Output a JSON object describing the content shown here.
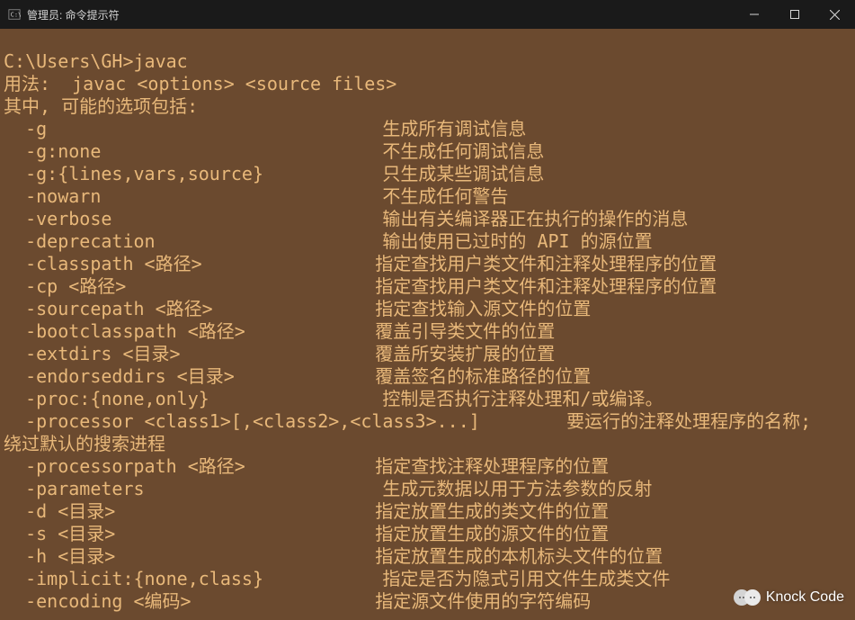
{
  "window": {
    "title": "管理员: 命令提示符"
  },
  "terminal": {
    "prompt_prefix": "C:\\Users\\GH>",
    "command": "javac",
    "usage_label": "用法:",
    "usage_cmd": "javac <options> <source files>",
    "options_intro": "其中, 可能的选项包括:",
    "options": [
      {
        "flag": "-g",
        "desc": "生成所有调试信息"
      },
      {
        "flag": "-g:none",
        "desc": "不生成任何调试信息"
      },
      {
        "flag": "-g:{lines,vars,source}",
        "desc": "只生成某些调试信息"
      },
      {
        "flag": "-nowarn",
        "desc": "不生成任何警告"
      },
      {
        "flag": "-verbose",
        "desc": "输出有关编译器正在执行的操作的消息"
      },
      {
        "flag": "-deprecation",
        "desc": "输出使用已过时的 API 的源位置"
      },
      {
        "flag": "-classpath <路径>",
        "desc": "指定查找用户类文件和注释处理程序的位置"
      },
      {
        "flag": "-cp <路径>",
        "desc": "指定查找用户类文件和注释处理程序的位置"
      },
      {
        "flag": "-sourcepath <路径>",
        "desc": "指定查找输入源文件的位置"
      },
      {
        "flag": "-bootclasspath <路径>",
        "desc": "覆盖引导类文件的位置"
      },
      {
        "flag": "-extdirs <目录>",
        "desc": "覆盖所安装扩展的位置"
      },
      {
        "flag": "-endorseddirs <目录>",
        "desc": "覆盖签名的标准路径的位置"
      },
      {
        "flag": "-proc:{none,only}",
        "desc": "控制是否执行注释处理和/或编译。"
      }
    ],
    "processor_flag": "-processor <class1>[,<class2>,<class3>...]",
    "processor_desc": "要运行的注释处理程序的名称;",
    "processor_cont": "绕过默认的搜索进程",
    "options2": [
      {
        "flag": "-processorpath <路径>",
        "desc": "指定查找注释处理程序的位置"
      },
      {
        "flag": "-parameters",
        "desc": "生成元数据以用于方法参数的反射"
      },
      {
        "flag": "-d <目录>",
        "desc": "指定放置生成的类文件的位置"
      },
      {
        "flag": "-s <目录>",
        "desc": "指定放置生成的源文件的位置"
      },
      {
        "flag": "-h <目录>",
        "desc": "指定放置生成的本机标头文件的位置"
      },
      {
        "flag": "-implicit:{none,class}",
        "desc": "指定是否为隐式引用文件生成类文件"
      },
      {
        "flag": "-encoding <编码>",
        "desc": "指定源文件使用的字符编码"
      }
    ]
  },
  "watermark": {
    "text": "Knock Code"
  }
}
